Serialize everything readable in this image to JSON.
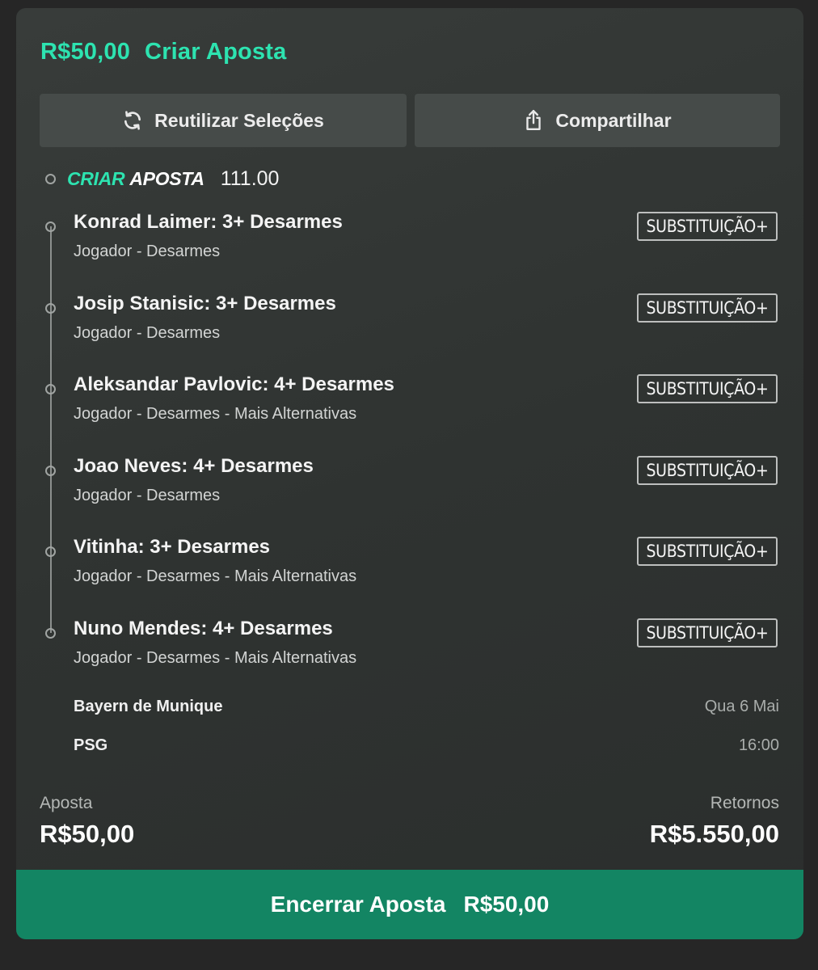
{
  "header": {
    "amount": "R$50,00",
    "title": "Criar Aposta"
  },
  "actions": {
    "reuse_label": "Reutilizar Seleções",
    "share_label": "Compartilhar"
  },
  "bet_builder": {
    "brand_part1": "CRIAR",
    "brand_part2": "APOSTA",
    "odds": "111.00"
  },
  "selections": [
    {
      "title": "Konrad Laimer: 3+ Desarmes",
      "subtitle": "Jogador - Desarmes",
      "sub_label": "SUBSTITUIÇÃO+"
    },
    {
      "title": "Josip Stanisic: 3+ Desarmes",
      "subtitle": "Jogador - Desarmes",
      "sub_label": "SUBSTITUIÇÃO+"
    },
    {
      "title": "Aleksandar Pavlovic: 4+ Desarmes",
      "subtitle": "Jogador - Desarmes - Mais Alternativas",
      "sub_label": "SUBSTITUIÇÃO+"
    },
    {
      "title": "Joao Neves: 4+ Desarmes",
      "subtitle": "Jogador - Desarmes",
      "sub_label": "SUBSTITUIÇÃO+"
    },
    {
      "title": "Vitinha: 3+ Desarmes",
      "subtitle": "Jogador - Desarmes - Mais Alternativas",
      "sub_label": "SUBSTITUIÇÃO+"
    },
    {
      "title": "Nuno Mendes: 4+ Desarmes",
      "subtitle": "Jogador - Desarmes - Mais Alternativas",
      "sub_label": "SUBSTITUIÇÃO+"
    }
  ],
  "match": {
    "home": "Bayern de Munique",
    "away": "PSG",
    "date": "Qua 6 Mai",
    "time": "16:00"
  },
  "summary": {
    "stake_label": "Aposta",
    "stake_value": "R$50,00",
    "returns_label": "Retornos",
    "returns_value": "R$5.550,00"
  },
  "cashout": {
    "label": "Encerrar Aposta",
    "amount": "R$50,00"
  },
  "colors": {
    "accent": "#2de3b0",
    "cashout_bg": "#138563",
    "card_bg": "#323634",
    "page_bg": "#262626"
  }
}
